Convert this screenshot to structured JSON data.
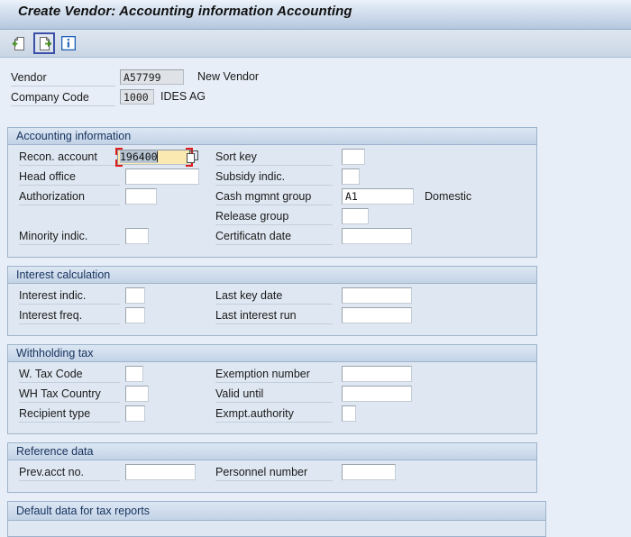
{
  "window": {
    "title": "Create Vendor: Accounting information Accounting"
  },
  "toolbar": {
    "buttons": [
      {
        "name": "back-page-icon",
        "tooltip": "Previous screen"
      },
      {
        "name": "next-page-icon",
        "tooltip": "Next screen"
      },
      {
        "name": "info-icon",
        "tooltip": "Information"
      }
    ]
  },
  "key_fields": {
    "vendor": {
      "label": "Vendor",
      "value": "A57799",
      "description": "New Vendor"
    },
    "company_code": {
      "label": "Company Code",
      "value": "1000",
      "description": "IDES AG"
    }
  },
  "groups": {
    "accounting_information": {
      "title": "Accounting information",
      "fields": {
        "recon_account": {
          "label": "Recon. account",
          "value": "196400"
        },
        "head_office": {
          "label": "Head office",
          "value": ""
        },
        "authorization": {
          "label": "Authorization",
          "value": ""
        },
        "minority_indic": {
          "label": "Minority indic.",
          "value": ""
        },
        "sort_key": {
          "label": "Sort key",
          "value": ""
        },
        "subsidy_indic": {
          "label": "Subsidy indic.",
          "value": ""
        },
        "cash_mgmnt_group": {
          "label": "Cash mgmnt group",
          "value": "A1",
          "description": "Domestic"
        },
        "release_group": {
          "label": "Release group",
          "value": ""
        },
        "certificatn_date": {
          "label": "Certificatn date",
          "value": ""
        }
      }
    },
    "interest_calculation": {
      "title": "Interest calculation",
      "fields": {
        "interest_indic": {
          "label": "Interest indic.",
          "value": ""
        },
        "interest_freq": {
          "label": "Interest freq.",
          "value": ""
        },
        "last_key_date": {
          "label": "Last key date",
          "value": ""
        },
        "last_interest_run": {
          "label": "Last interest run",
          "value": ""
        }
      }
    },
    "withholding_tax": {
      "title": "Withholding tax",
      "fields": {
        "w_tax_code": {
          "label": "W. Tax Code",
          "value": ""
        },
        "wh_tax_country": {
          "label": "WH Tax Country",
          "value": ""
        },
        "recipient_type": {
          "label": "Recipient type",
          "value": ""
        },
        "exemption_number": {
          "label": "Exemption number",
          "value": ""
        },
        "valid_until": {
          "label": "Valid  until",
          "value": ""
        },
        "exmpt_authority": {
          "label": "Exmpt.authority",
          "value": ""
        }
      }
    },
    "reference_data": {
      "title": "Reference data",
      "fields": {
        "prev_acct_no": {
          "label": "Prev.acct no.",
          "value": ""
        },
        "personnel_number": {
          "label": "Personnel number",
          "value": ""
        }
      }
    },
    "default_data_tax_reports": {
      "title": "Default data for tax reports"
    }
  },
  "colors": {
    "title_gradient_top": "#eef3fa",
    "title_gradient_bottom": "#adc2da",
    "toolbar_bg": "#d3dde9",
    "page_bg": "#e8eef7",
    "group_bg": "#dfe8f2",
    "group_border": "#9db3cc",
    "group_header_text": "#15325c",
    "focus_field_bg": "#fbe9b2",
    "selection_marker": "#e01b1b",
    "focus_button_border": "#3b4fa8",
    "readonly_field_bg": "#dfe2e6"
  }
}
